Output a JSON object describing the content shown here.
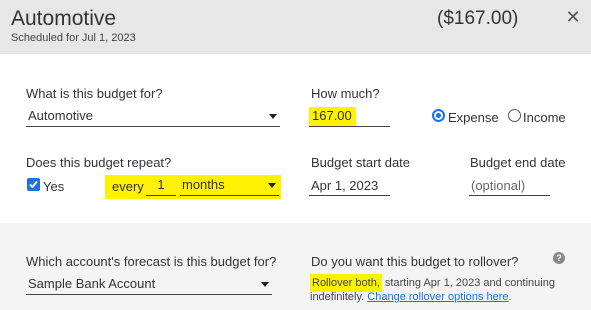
{
  "header": {
    "title": "Automotive",
    "subtitle": "Scheduled for Jul 1, 2023",
    "amount": "($167.00)",
    "close_icon": "close-icon"
  },
  "budget_for": {
    "label": "What is this budget for?",
    "value": "Automotive"
  },
  "how_much": {
    "label": "How much?",
    "value": "167.00",
    "options": [
      {
        "label": "Expense",
        "selected": true
      },
      {
        "label": "Income",
        "selected": false
      }
    ]
  },
  "repeat": {
    "label": "Does this budget repeat?",
    "checkbox_label": "Yes",
    "checked": true,
    "every_text": "every",
    "interval": "1",
    "unit": "months"
  },
  "start_date": {
    "label": "Budget start date",
    "value": "Apr 1, 2023"
  },
  "end_date": {
    "label": "Budget end date",
    "placeholder": "(optional)"
  },
  "account": {
    "label": "Which account's forecast is this budget for?",
    "value": "Sample Bank Account"
  },
  "rollover": {
    "label": "Do you want this budget to rollover?",
    "highlight": "Rollover both,",
    "text": " starting Apr 1, 2023 and continuing indefinitely. ",
    "link": "Change rollover options here",
    "end": "."
  },
  "colors": {
    "header_bg": "#e7e7e7",
    "highlight": "#fff200",
    "accent": "#1a73e8"
  }
}
